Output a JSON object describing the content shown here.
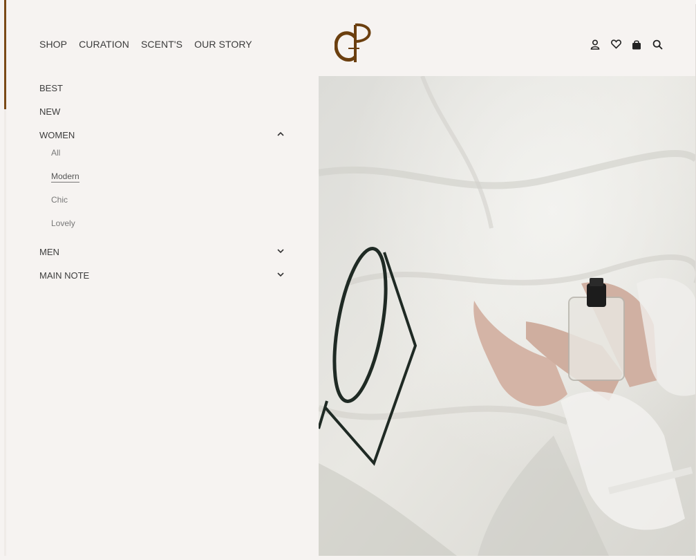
{
  "nav": {
    "items": [
      {
        "label": "SHOP"
      },
      {
        "label": "CURATION"
      },
      {
        "label": "SCENT'S"
      },
      {
        "label": "OUR STORY"
      }
    ]
  },
  "icons": [
    "user-icon",
    "heart-icon",
    "shopping-bag-icon",
    "search-icon"
  ],
  "brand": {
    "accent": "#6b3f0f"
  },
  "sidebar": {
    "items": [
      {
        "label": "BEST"
      },
      {
        "label": "NEW"
      },
      {
        "label": "WOMEN",
        "expanded": true
      },
      {
        "label": "MEN",
        "expanded": false
      },
      {
        "label": "MAIN NOTE",
        "expanded": false
      }
    ],
    "women_sub": [
      {
        "label": "All"
      },
      {
        "label": "Modern",
        "active": true
      },
      {
        "label": "Chic"
      },
      {
        "label": "Lovely"
      }
    ]
  }
}
